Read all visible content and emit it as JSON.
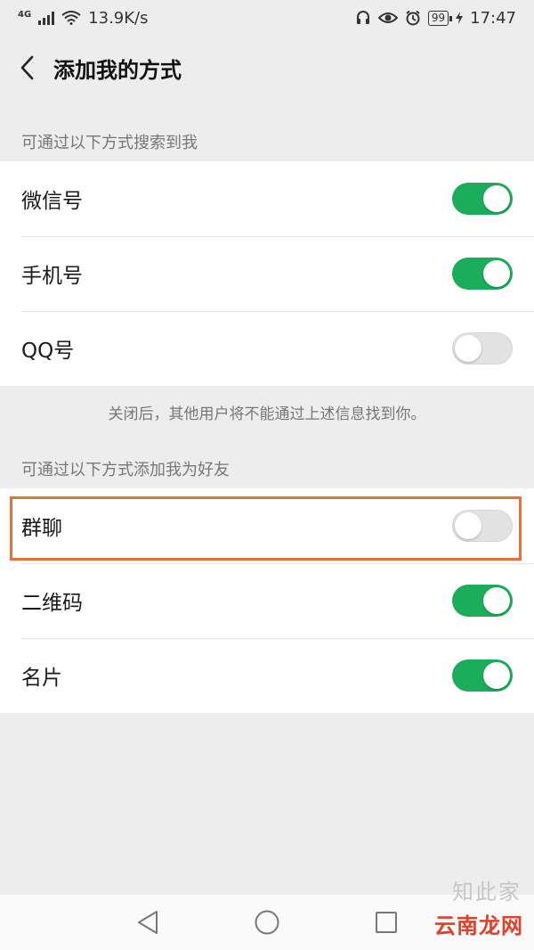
{
  "status_bar": {
    "network": "4G",
    "speed": "13.9K/s",
    "battery": "99",
    "time": "17:47"
  },
  "header": {
    "title": "添加我的方式"
  },
  "search_section": {
    "label": "可通过以下方式搜索到我",
    "items": [
      {
        "label": "微信号",
        "enabled": true
      },
      {
        "label": "手机号",
        "enabled": true
      },
      {
        "label": "QQ号",
        "enabled": false
      }
    ],
    "note": "关闭后，其他用户将不能通过上述信息找到你。"
  },
  "add_section": {
    "label": "可通过以下方式添加我为好友",
    "items": [
      {
        "label": "群聊",
        "enabled": false
      },
      {
        "label": "二维码",
        "enabled": true
      },
      {
        "label": "名片",
        "enabled": true
      }
    ]
  },
  "watermark": {
    "brand": "云南龙网",
    "faint": "知此家"
  },
  "colors": {
    "toggle_on": "#1aad5a",
    "toggle_off": "#e2e2e2",
    "highlight": "#e8703a"
  }
}
